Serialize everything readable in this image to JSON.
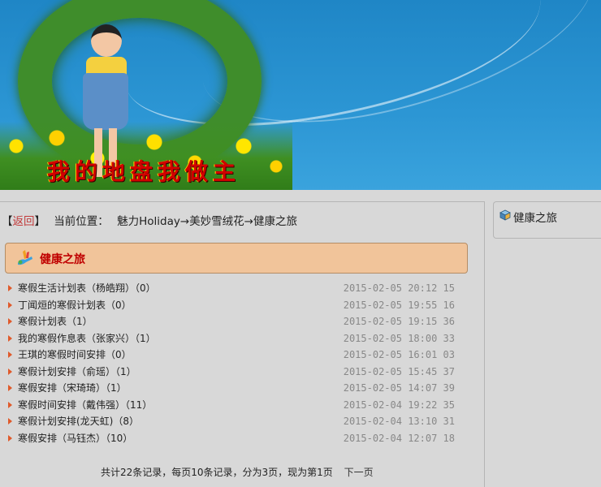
{
  "banner": {
    "title": "我的地盘我做主"
  },
  "breadcrumb": {
    "open_bracket": "【",
    "back": "返回",
    "close_bracket": "】",
    "label": "当前位置：",
    "path": "魅力Holiday→美妙雪绒花→健康之旅"
  },
  "section": {
    "title": "健康之旅",
    "icon": "hand-pen-icon"
  },
  "items": [
    {
      "title": "寒假生活计划表（杨皓翔）（0）",
      "date": "2015-02-05 20:12 15"
    },
    {
      "title": "丁闻烜的寒假计划表（0）",
      "date": "2015-02-05 19:55 16"
    },
    {
      "title": "寒假计划表（1）",
      "date": "2015-02-05 19:15 36"
    },
    {
      "title": "我的寒假作息表（张家兴）（1）",
      "date": "2015-02-05 18:00 33"
    },
    {
      "title": "王琪的寒假时间安排（0）",
      "date": "2015-02-05 16:01 03"
    },
    {
      "title": "寒假计划安排（俞瑶）（1）",
      "date": "2015-02-05 15:45 37"
    },
    {
      "title": "寒假安排（宋琦琦）（1）",
      "date": "2015-02-05 14:07 39"
    },
    {
      "title": "寒假时间安排（戴伟强）（11）",
      "date": "2015-02-04 19:22 35"
    },
    {
      "title": "寒假计划安排(龙天虹)（8）",
      "date": "2015-02-04 13:10 31"
    },
    {
      "title": "寒假安排（马钰杰）（10）",
      "date": "2015-02-04 12:07 18"
    }
  ],
  "pager": {
    "summary": "共计22条记录，每页10条记录，分为3页，现为第1页",
    "next": "下一页"
  },
  "side": {
    "title": "健康之旅",
    "icon": "box-icon"
  }
}
